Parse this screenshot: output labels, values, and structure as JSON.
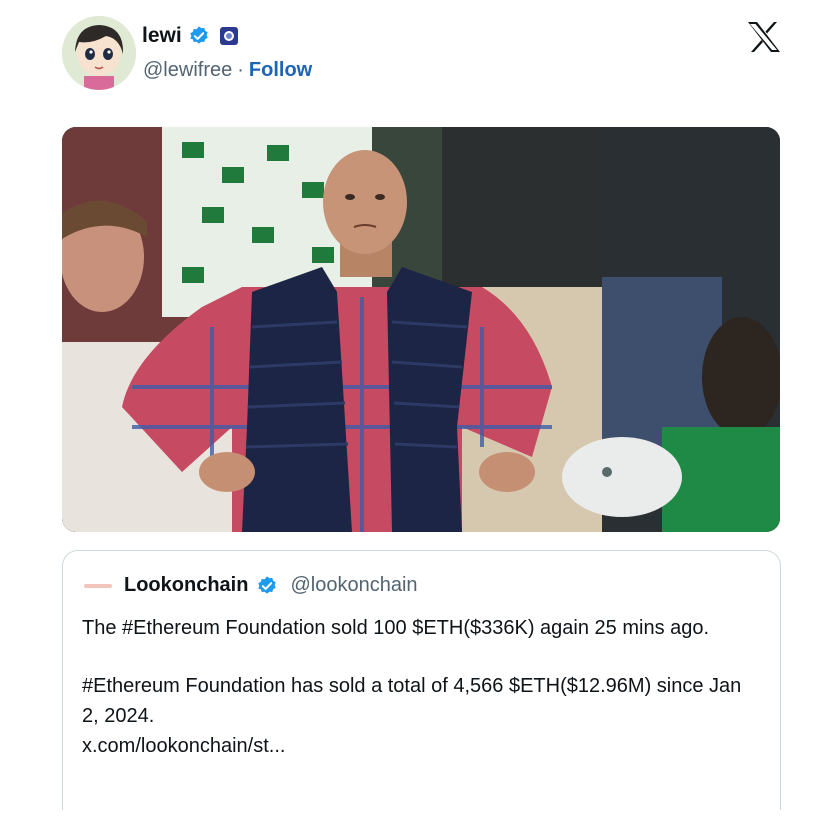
{
  "author": {
    "display_name": "lewi",
    "handle": "@lewifree",
    "separator": "·",
    "follow_label": "Follow",
    "verified_icon": "verified-badge-icon",
    "affiliation_icon": "affiliation-badge-icon"
  },
  "platform": {
    "logo_icon": "x-logo-icon"
  },
  "media": {
    "image_icon": "meme-photo-disappointed-fan"
  },
  "quoted_post": {
    "display_name": "Lookonchain",
    "handle": "@lookonchain",
    "line1": "The #Ethereum Foundation sold 100 $ETH($336K) again 25 mins ago.",
    "line2": "#Ethereum Foundation has sold a total of 4,566 $ETH($12.96M) since Jan 2, 2024.",
    "link": "x.com/lookonchain/st..."
  },
  "colors": {
    "verified_blue": "#1d9bf0",
    "follow_blue": "#1d64b3",
    "border": "#cfd9de"
  }
}
